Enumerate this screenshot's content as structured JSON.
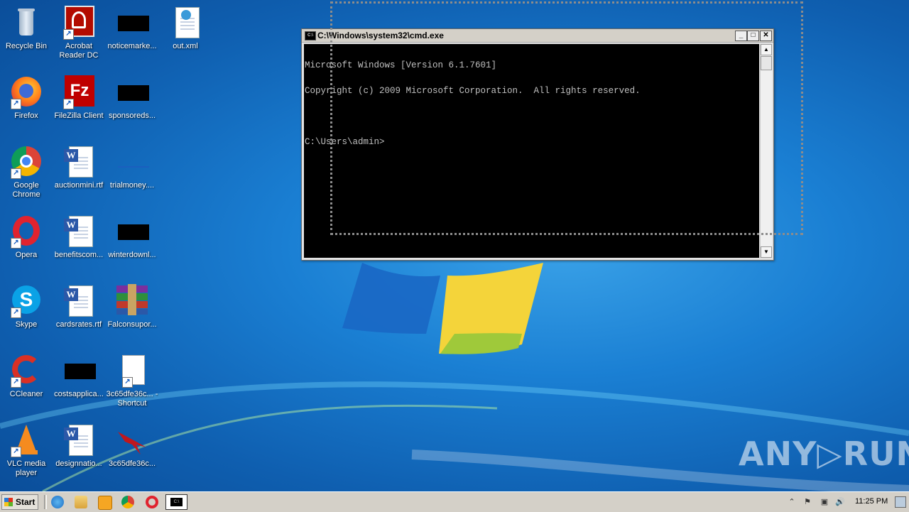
{
  "desktop": {
    "icons": [
      {
        "label": "Recycle Bin"
      },
      {
        "label": "Acrobat Reader DC"
      },
      {
        "label": "noticemarke..."
      },
      {
        "label": "out.xml"
      },
      {
        "label": "Firefox"
      },
      {
        "label": "FileZilla Client"
      },
      {
        "label": "sponsoreds..."
      },
      {
        "label": "Google Chrome"
      },
      {
        "label": "auctionmini.rtf"
      },
      {
        "label": "trialmoney...."
      },
      {
        "label": "Opera"
      },
      {
        "label": "benefitscom..."
      },
      {
        "label": "winterdownl..."
      },
      {
        "label": "Skype"
      },
      {
        "label": "cardsrates.rtf"
      },
      {
        "label": "Falconsupor..."
      },
      {
        "label": "CCleaner"
      },
      {
        "label": "costsapplica..."
      },
      {
        "label": "3c65dfe36c... - Shortcut"
      },
      {
        "label": "VLC media player"
      },
      {
        "label": "designnatio..."
      },
      {
        "label": "3c65dfe36c..."
      }
    ]
  },
  "cmd_window": {
    "title": "C:\\Windows\\system32\\cmd.exe",
    "lines": [
      "Microsoft Windows [Version 6.1.7601]",
      "Copyright (c) 2009 Microsoft Corporation.  All rights reserved.",
      "",
      "C:\\Users\\admin>"
    ],
    "icon_text": "C:\\",
    "minimize_glyph": "_",
    "maximize_glyph": "□",
    "close_glyph": "✕",
    "scroll_up_glyph": "▲",
    "scroll_down_glyph": "▼"
  },
  "taskbar": {
    "start_label": "Start",
    "cmd_icon_text": "C:\\",
    "clock": "11:25 PM",
    "tray_glyphs": [
      "⌃",
      "⚑",
      "▣",
      "🔊"
    ]
  },
  "watermark": "ANY▷RUN"
}
